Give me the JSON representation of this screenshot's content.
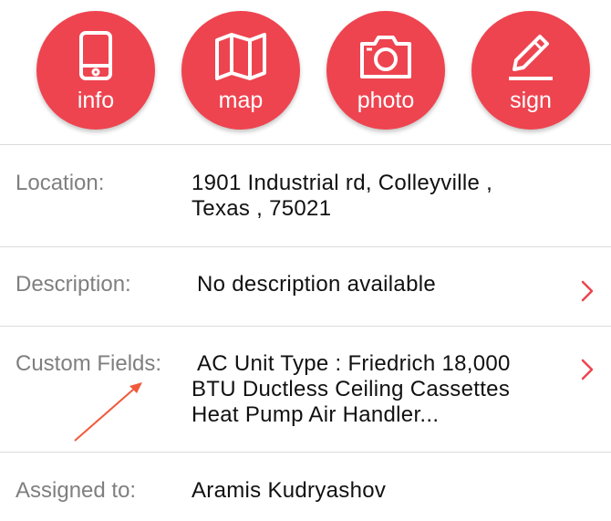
{
  "actions": [
    {
      "label": "info",
      "icon": "tablet-icon"
    },
    {
      "label": "map",
      "icon": "map-icon"
    },
    {
      "label": "photo",
      "icon": "camera-icon"
    },
    {
      "label": "sign",
      "icon": "pencil-icon"
    }
  ],
  "details": {
    "location": {
      "label": "Location:",
      "line1": "1901 Industrial rd, Colleyville ,",
      "line2": "Texas , 75021"
    },
    "description": {
      "label": "Description:",
      "value": "No description available"
    },
    "custom_fields": {
      "label": "Custom Fields:",
      "line1": "AC Unit Type : Friedrich 18,000",
      "line2": "BTU Ductless Ceiling Cassettes",
      "line3": "Heat Pump Air Handler..."
    },
    "assigned_to": {
      "label": "Assigned to:",
      "value": "Aramis Kudryashov"
    }
  },
  "colors": {
    "accent": "#ee4450",
    "label_text": "#7f7f7f",
    "value_text": "#111111",
    "annotation_arrow": "#f05a3c"
  }
}
